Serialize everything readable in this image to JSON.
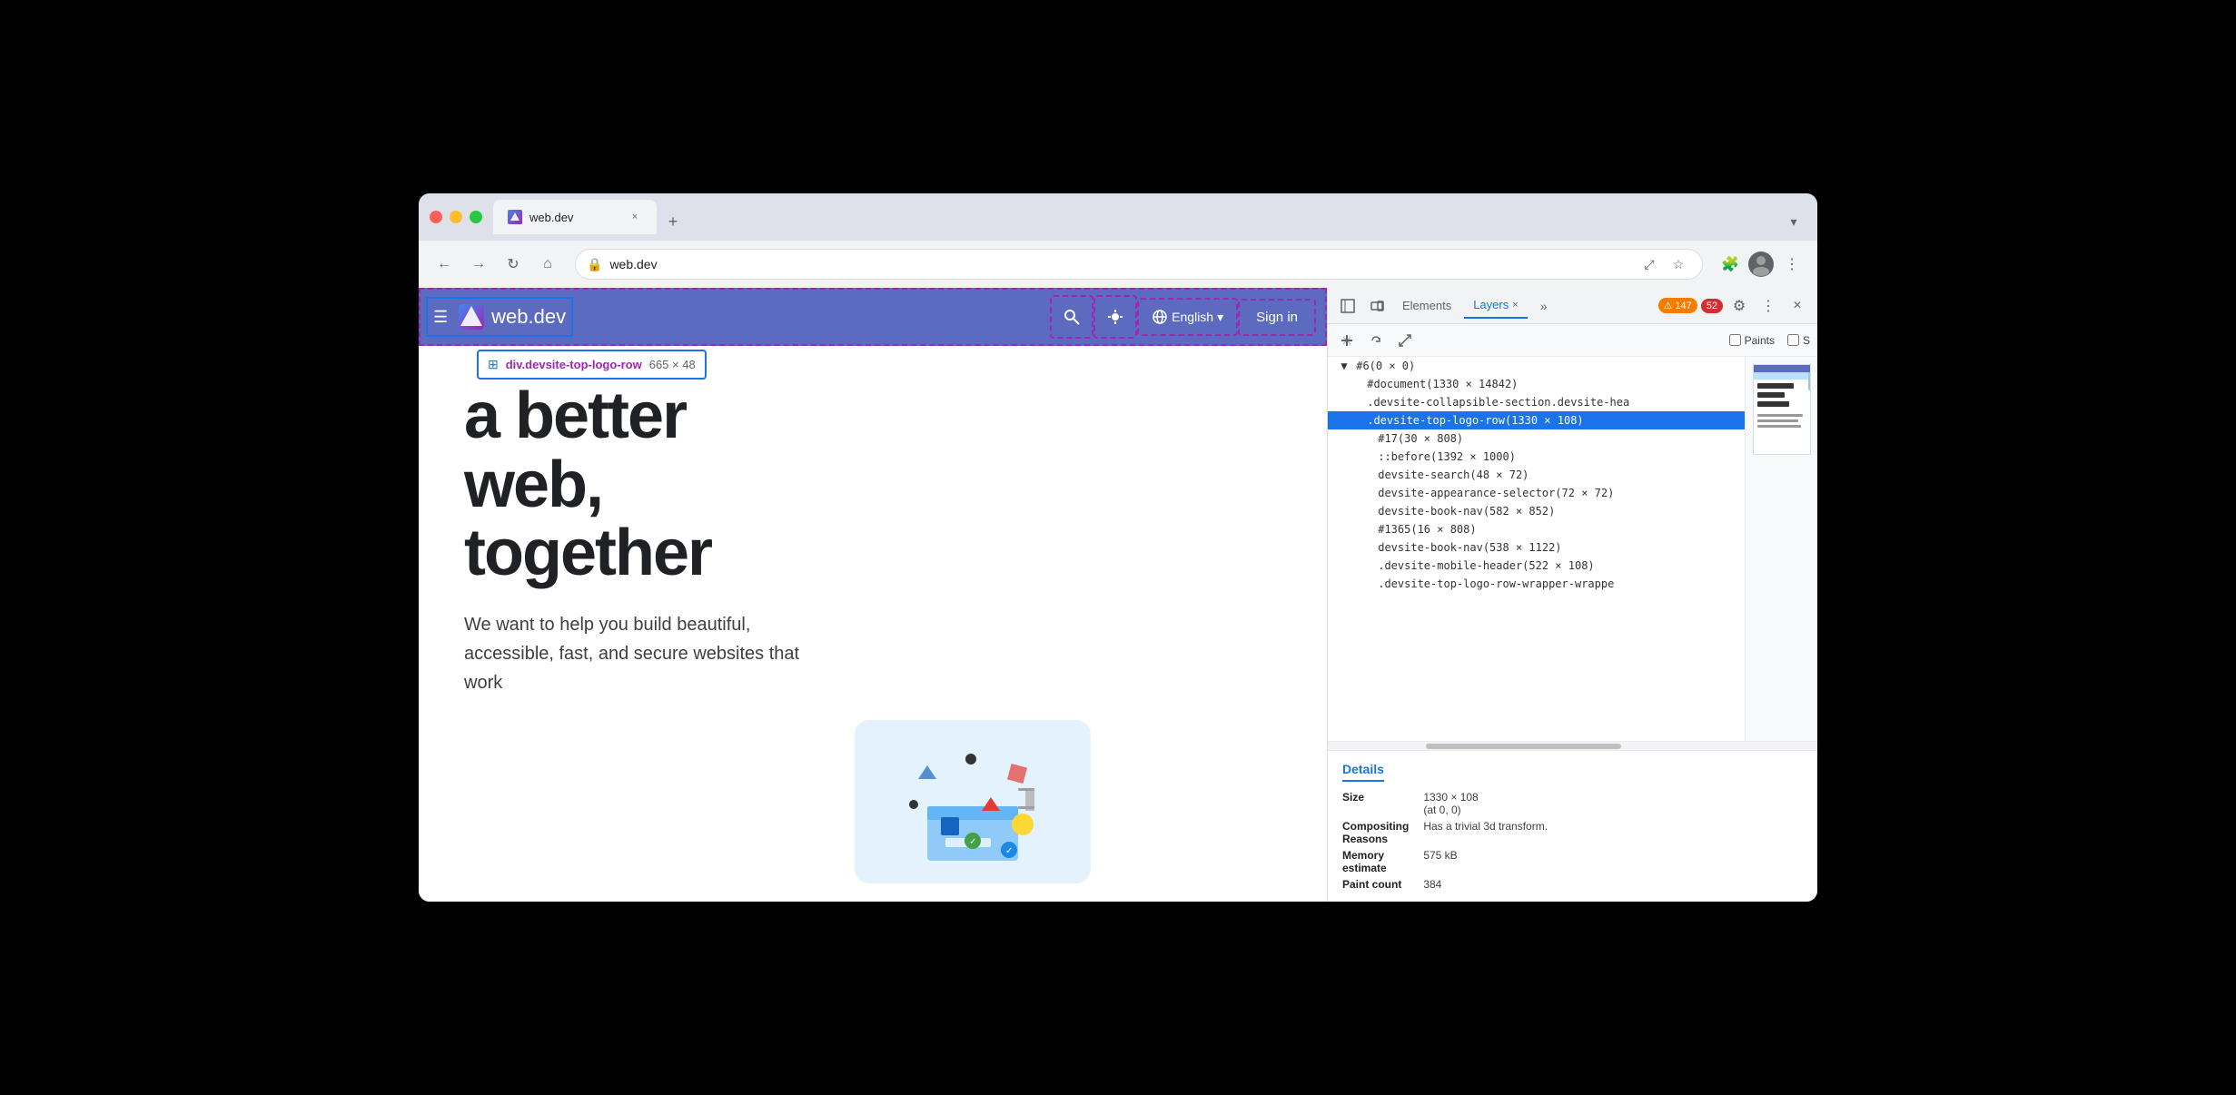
{
  "browser": {
    "tab_title": "web.dev",
    "address": "web.dev",
    "chevron_label": "▾",
    "new_tab_label": "+",
    "tab_close_label": "×"
  },
  "nav": {
    "back_label": "←",
    "forward_label": "→",
    "refresh_label": "↻",
    "home_label": "⌂",
    "address_icon": "🔒",
    "share_label": "⤢",
    "bookmark_label": "☆",
    "extensions_label": "🧩",
    "more_label": "⋮"
  },
  "site_header": {
    "menu_icon": "☰",
    "logo_text": "web.dev",
    "lang_text": "English",
    "lang_arrow": "▾",
    "signin_text": "Sign in"
  },
  "element_tooltip": {
    "name": "div.devsite-top-logo-row",
    "size": "665 × 48"
  },
  "page_content": {
    "headline_line1": "a better",
    "headline_line2": "web,",
    "headline_line3": "together",
    "subtitle": "We want to help you build beautiful, accessible, fast, and secure websites that work"
  },
  "devtools": {
    "toolbar": {
      "inspect_icon": "⊞",
      "device_icon": "▭",
      "elements_tab": "Elements",
      "layers_tab": "Layers",
      "layers_close": "×",
      "more_tabs": "»",
      "warning_icon": "⚠",
      "warning_count": "147",
      "error_count": "52",
      "settings_icon": "⚙",
      "more_icon": "⋮",
      "close_icon": "×"
    },
    "layers_toolbar": {
      "pan_icon": "✢",
      "rotate_icon": "↺",
      "resize_icon": "⤢",
      "paints_label": "Paints",
      "s_label": "S"
    },
    "layer_tree": [
      {
        "indent": 0,
        "text": "#6(0 × 0)",
        "arrow": "▼"
      },
      {
        "indent": 1,
        "text": "#document(1330 × 14842)",
        "arrow": ""
      },
      {
        "indent": 1,
        "text": ".devsite-collapsible-section.devsite-hea",
        "arrow": ""
      },
      {
        "indent": 1,
        "text": ".devsite-top-logo-row(1330 × 108)",
        "arrow": "",
        "selected": true
      },
      {
        "indent": 2,
        "text": "#17(30 × 808)",
        "arrow": ""
      },
      {
        "indent": 2,
        "text": "::before(1392 × 1000)",
        "arrow": ""
      },
      {
        "indent": 2,
        "text": "devsite-search(48 × 72)",
        "arrow": ""
      },
      {
        "indent": 2,
        "text": "devsite-appearance-selector(72 × 72)",
        "arrow": ""
      },
      {
        "indent": 2,
        "text": "devsite-book-nav(582 × 852)",
        "arrow": ""
      },
      {
        "indent": 2,
        "text": "#1365(16 × 808)",
        "arrow": ""
      },
      {
        "indent": 2,
        "text": "devsite-book-nav(538 × 1122)",
        "arrow": ""
      },
      {
        "indent": 2,
        "text": ".devsite-mobile-header(522 × 108)",
        "arrow": ""
      },
      {
        "indent": 2,
        "text": ".devsite-top-logo-row-wrapper-wrappe",
        "arrow": ""
      }
    ],
    "details": {
      "title": "Details",
      "size_label": "Size",
      "size_value": "1330 × 108\n(at 0, 0)",
      "compositing_label": "Compositing\nReasons",
      "compositing_value": "Has a trivial 3d transform.",
      "memory_label": "Memory\nestimate",
      "memory_value": "575 kB",
      "paintcount_label": "Paint count",
      "paintcount_value": "384"
    }
  }
}
